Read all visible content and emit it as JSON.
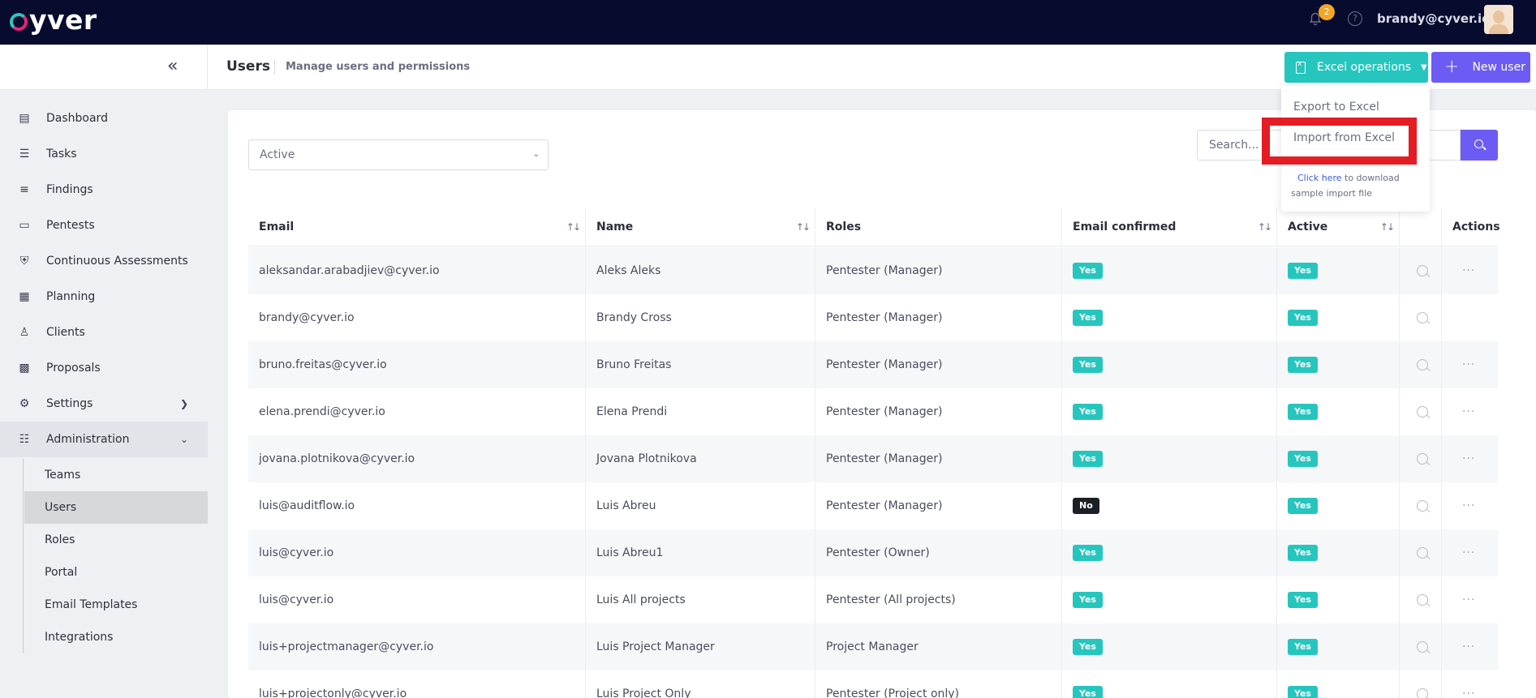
{
  "app": {
    "logo_text": "yver",
    "logo_mark": "c"
  },
  "topbar": {
    "notification_count": "2",
    "help_glyph": "?",
    "user_email": "brandy@cyver.io",
    "icons": [
      "bell-icon",
      "help-icon",
      "avatar"
    ]
  },
  "header": {
    "collapse_glyph": "«",
    "title": "Users",
    "subtitle": "Manage users and permissions",
    "excel_button": "Excel operations",
    "new_user_button": "New user"
  },
  "dropdown": {
    "export": "Export to Excel",
    "import": "Import from Excel",
    "link": "Click here",
    "link_suffix": "to download sample import file"
  },
  "sidebar": {
    "items": [
      {
        "label": "Dashboard",
        "icon": "dashboard-icon"
      },
      {
        "label": "Tasks",
        "icon": "tasks-icon"
      },
      {
        "label": "Findings",
        "icon": "findings-icon"
      },
      {
        "label": "Pentests",
        "icon": "pentests-icon"
      },
      {
        "label": "Continuous Assessments",
        "icon": "shield-icon"
      },
      {
        "label": "Planning",
        "icon": "calendar-icon"
      },
      {
        "label": "Clients",
        "icon": "clients-icon"
      },
      {
        "label": "Proposals",
        "icon": "proposals-icon"
      },
      {
        "label": "Settings",
        "icon": "gear-icon"
      },
      {
        "label": "Administration",
        "icon": "admin-icon"
      }
    ],
    "subitems": [
      "Teams",
      "Users",
      "Roles",
      "Portal",
      "Email Templates",
      "Integrations"
    ],
    "active_subitem": "Users"
  },
  "filters": {
    "status_value": "Active",
    "search_placeholder": "Search..."
  },
  "table": {
    "columns": [
      "Email",
      "Name",
      "Roles",
      "Email confirmed",
      "Active",
      "",
      "Actions"
    ],
    "rows": [
      {
        "email": "aleksandar.arabadjiev@cyver.io",
        "name": "Aleks Aleks",
        "role": "Pentester (Manager)",
        "confirmed": "Yes",
        "active": "Yes",
        "has_actions": true
      },
      {
        "email": "brandy@cyver.io",
        "name": "Brandy Cross",
        "role": "Pentester (Manager)",
        "confirmed": "Yes",
        "active": "Yes",
        "has_actions": false
      },
      {
        "email": "bruno.freitas@cyver.io",
        "name": "Bruno Freitas",
        "role": "Pentester (Manager)",
        "confirmed": "Yes",
        "active": "Yes",
        "has_actions": true
      },
      {
        "email": "elena.prendi@cyver.io",
        "name": "Elena Prendi",
        "role": "Pentester (Manager)",
        "confirmed": "Yes",
        "active": "Yes",
        "has_actions": true
      },
      {
        "email": "jovana.plotnikova@cyver.io",
        "name": "Jovana Plotnikova",
        "role": "Pentester (Manager)",
        "confirmed": "Yes",
        "active": "Yes",
        "has_actions": true
      },
      {
        "email": "luis@auditflow.io",
        "name": "Luis Abreu",
        "role": "Pentester (Manager)",
        "confirmed": "No",
        "active": "Yes",
        "has_actions": true
      },
      {
        "email": "luis@cyver.io",
        "name": "Luis Abreu1",
        "role": "Pentester (Owner)",
        "confirmed": "Yes",
        "active": "Yes",
        "has_actions": true
      },
      {
        "email": "luis@cyver.io",
        "name": "Luis All projects",
        "role": "Pentester (All projects)",
        "confirmed": "Yes",
        "active": "Yes",
        "has_actions": true
      },
      {
        "email": "luis+projectmanager@cyver.io",
        "name": "Luis Project Manager",
        "role": "Project Manager",
        "confirmed": "Yes",
        "active": "Yes",
        "has_actions": true
      },
      {
        "email": "luis+projectonly@cyver.io",
        "name": "Luis Project Only",
        "role": "Pentester (Project only)",
        "confirmed": "Yes",
        "active": "Yes",
        "has_actions": true
      }
    ]
  },
  "colors": {
    "topbar": "#070b2d",
    "teal": "#26c6be",
    "purple": "#6d5cf3",
    "highlight_red": "#e41c24"
  }
}
